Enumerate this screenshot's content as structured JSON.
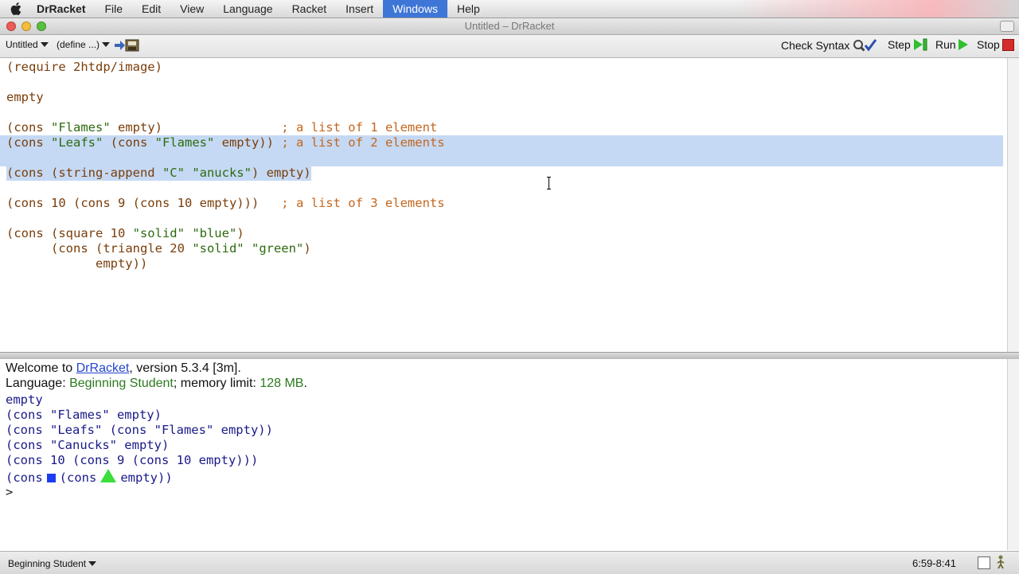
{
  "menubar": {
    "app_name": "DrRacket",
    "items": [
      "File",
      "Edit",
      "View",
      "Language",
      "Racket",
      "Insert",
      "Windows",
      "Help"
    ],
    "active_item": "Windows"
  },
  "window": {
    "title": "Untitled – DrRacket",
    "colors": {
      "close": "#ee5b55",
      "minimize": "#f4bd3c",
      "zoom": "#58c140"
    }
  },
  "toolbar": {
    "file_menu_label": "Untitled",
    "define_menu_label": "(define ...)",
    "check_syntax_label": "Check Syntax",
    "step_label": "Step",
    "run_label": "Run",
    "stop_label": "Stop"
  },
  "editor": {
    "line1": {
      "a": "(require 2htdp/image)"
    },
    "line2": {
      "a": "empty"
    },
    "line3": {
      "a": "(cons ",
      "s1": "\"Flames\"",
      "b": " empty)",
      "pad": "                ",
      "comment": "; a list of 1 element"
    },
    "line4": {
      "a": "(cons ",
      "s1": "\"Leafs\"",
      "b": " (cons ",
      "s2": "\"Flames\"",
      "c": " empty)) ",
      "comment": "; a list of 2 elements"
    },
    "line5": {
      "a": "(cons (string-append ",
      "s1": "\"C\"",
      "b": " ",
      "s2": "\"anucks\"",
      "c": ") empty)"
    },
    "line6": {
      "a": "(cons 10 (cons 9 (cons 10 empty)))",
      "pad": "   ",
      "comment": "; a list of 3 elements"
    },
    "line7": {
      "a": "(cons (square 10 ",
      "s1": "\"solid\"",
      "b": " ",
      "s2": "\"blue\"",
      "c": ")"
    },
    "line8": {
      "indent": "      ",
      "a": "(cons (triangle 20 ",
      "s1": "\"solid\"",
      "b": " ",
      "s2": "\"green\"",
      "c": ")"
    },
    "line9": {
      "indent": "            ",
      "a": "empty))"
    },
    "highlight_color": "#c5d9f4"
  },
  "interactions": {
    "welcome_prefix": "Welcome to ",
    "welcome_link": "DrRacket",
    "welcome_suffix": ", version 5.3.4 [3m].",
    "language_prefix": "Language: ",
    "language_name": "Beginning Student",
    "memory_prefix": "; memory limit: ",
    "memory_value": "128 MB",
    "memory_suffix": ".",
    "outputs": [
      "empty",
      "(cons \"Flames\" empty)",
      "(cons \"Leafs\" (cons \"Flames\" empty))",
      "(cons \"Canucks\" empty)",
      "(cons 10 (cons 9 (cons 10 empty)))"
    ],
    "image_line": {
      "a": "(cons",
      "b": "(cons",
      "c": "empty))"
    },
    "prompt": ">"
  },
  "statusbar": {
    "language_label": "Beginning Student",
    "position": "6:59-8:41"
  }
}
